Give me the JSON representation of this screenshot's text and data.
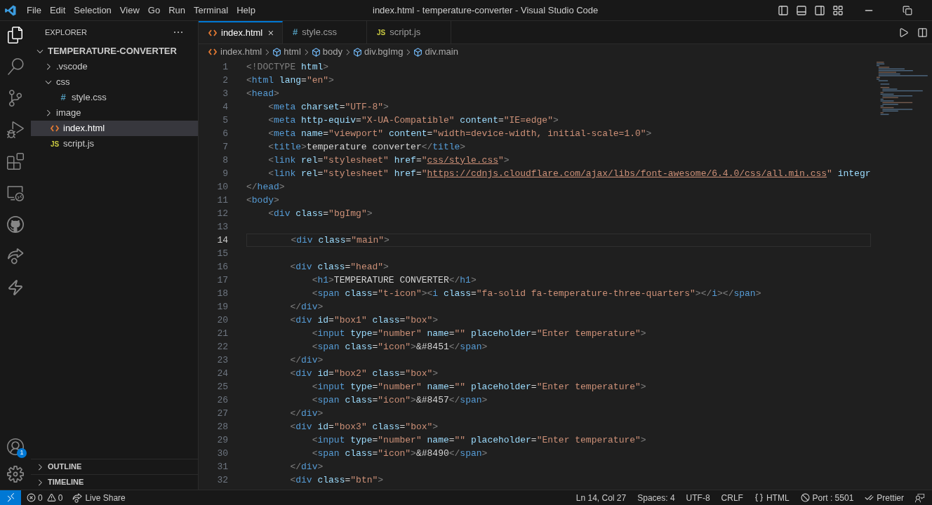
{
  "menu": [
    "File",
    "Edit",
    "Selection",
    "View",
    "Go",
    "Run",
    "Terminal",
    "Help"
  ],
  "window": {
    "title": "index.html - temperature-converter - Visual Studio Code"
  },
  "activity_bar": {
    "account_badge": "1"
  },
  "sidebar": {
    "title": "EXPLORER",
    "root": {
      "label": "TEMPERATURE-CONVERTER",
      "kind": "folder",
      "expanded": true,
      "selected": false,
      "children": [
        {
          "label": ".vscode",
          "kind": "folder",
          "expanded": false,
          "selected": false
        },
        {
          "label": "css",
          "kind": "folder",
          "expanded": true,
          "selected": false,
          "children": [
            {
              "label": "style.css",
              "kind": "css",
              "icon_text": "#",
              "selected": false
            }
          ]
        },
        {
          "label": "image",
          "kind": "folder",
          "expanded": false,
          "selected": false
        },
        {
          "label": "index.html",
          "kind": "html",
          "selected": true
        },
        {
          "label": "script.js",
          "kind": "js",
          "icon_text": "JS",
          "selected": false
        }
      ]
    },
    "sections": [
      {
        "label": "OUTLINE",
        "expanded": false
      },
      {
        "label": "TIMELINE",
        "expanded": false
      }
    ]
  },
  "tabs": [
    {
      "label": "index.html",
      "kind": "html",
      "selected": true
    },
    {
      "label": "style.css",
      "kind": "css",
      "icon_text": "#",
      "selected": false
    },
    {
      "label": "script.js",
      "kind": "js",
      "icon_text": "JS",
      "selected": false
    }
  ],
  "breadcrumb": [
    {
      "label": "index.html",
      "kind": "html"
    },
    {
      "label": "html",
      "kind": "element"
    },
    {
      "label": "body",
      "kind": "element"
    },
    {
      "label": "div.bgImg",
      "kind": "element"
    },
    {
      "label": "div.main",
      "kind": "element"
    }
  ],
  "editor": {
    "lines": [
      {
        "number": "1",
        "current": false,
        "parts": [
          {
            "kind": "code",
            "text": "<!DOCTYPE html>"
          }
        ]
      },
      {
        "number": "2",
        "current": false,
        "parts": [
          {
            "kind": "code",
            "text": "<html lang=\"en\">"
          }
        ]
      },
      {
        "number": "3",
        "current": false,
        "parts": [
          {
            "kind": "code",
            "text": "<head>"
          }
        ]
      },
      {
        "number": "4",
        "current": false,
        "parts": [
          {
            "kind": "code",
            "text": "    <meta charset=\"UTF-8\">"
          }
        ]
      },
      {
        "number": "5",
        "current": false,
        "parts": [
          {
            "kind": "code",
            "text": "    <meta http-equiv=\"X-UA-Compatible\" content=\"IE=edge\">"
          }
        ]
      },
      {
        "number": "6",
        "current": false,
        "parts": [
          {
            "kind": "code",
            "text": "    <meta name=\"viewport\" content=\"width=device-width, initial-scale=1.0\">"
          }
        ]
      },
      {
        "number": "7",
        "current": false,
        "parts": [
          {
            "kind": "code",
            "text": "    <title>temperature converter</title>"
          }
        ]
      },
      {
        "number": "8",
        "current": false,
        "parts": [
          {
            "kind": "code",
            "text": "    <link rel=\"stylesheet\" href=\""
          },
          {
            "kind": "link",
            "text": "css/style.css"
          },
          {
            "kind": "code",
            "text": "\">"
          }
        ]
      },
      {
        "number": "9",
        "current": false,
        "parts": [
          {
            "kind": "code",
            "text": "    <link rel=\"stylesheet\" href=\""
          },
          {
            "kind": "link",
            "text": "https://cdnjs.cloudflare.com/ajax/libs/font-awesome/6.4.0/css/all.min.css"
          },
          {
            "kind": "code",
            "text": "\" integr"
          }
        ]
      },
      {
        "number": "10",
        "current": false,
        "parts": [
          {
            "kind": "code",
            "text": "</head>"
          }
        ]
      },
      {
        "number": "11",
        "current": false,
        "parts": [
          {
            "kind": "code",
            "text": "<body>"
          }
        ]
      },
      {
        "number": "12",
        "current": false,
        "parts": [
          {
            "kind": "code",
            "text": "    <div class=\"bgImg\">"
          }
        ]
      },
      {
        "number": "13",
        "current": false
      },
      {
        "number": "14",
        "current": true,
        "parts": [
          {
            "kind": "code",
            "text": "        <div class=\"main\">"
          }
        ]
      },
      {
        "number": "15",
        "current": false
      },
      {
        "number": "16",
        "current": false,
        "parts": [
          {
            "kind": "code",
            "text": "        <div class=\"head\">"
          }
        ]
      },
      {
        "number": "17",
        "current": false,
        "parts": [
          {
            "kind": "code",
            "text": "            <h1>TEMPERATURE CONVERTER</h1>"
          }
        ]
      },
      {
        "number": "18",
        "current": false,
        "parts": [
          {
            "kind": "code",
            "text": "            <span class=\"t-icon\"><i class=\"fa-solid fa-temperature-three-quarters\"></i></span>"
          }
        ]
      },
      {
        "number": "19",
        "current": false,
        "parts": [
          {
            "kind": "code",
            "text": "        </div>"
          }
        ]
      },
      {
        "number": "20",
        "current": false,
        "parts": [
          {
            "kind": "code",
            "text": "        <div id=\"box1\" class=\"box\">"
          }
        ]
      },
      {
        "number": "21",
        "current": false,
        "parts": [
          {
            "kind": "code",
            "text": "            <input type=\"number\" name=\"\" placeholder=\"Enter temperature\">"
          }
        ]
      },
      {
        "number": "22",
        "current": false,
        "parts": [
          {
            "kind": "code",
            "text": "            <span class=\"icon\">&#8451</span>"
          }
        ]
      },
      {
        "number": "23",
        "current": false,
        "parts": [
          {
            "kind": "code",
            "text": "        </div>"
          }
        ]
      },
      {
        "number": "24",
        "current": false,
        "parts": [
          {
            "kind": "code",
            "text": "        <div id=\"box2\" class=\"box\">"
          }
        ]
      },
      {
        "number": "25",
        "current": false,
        "parts": [
          {
            "kind": "code",
            "text": "            <input type=\"number\" name=\"\" placeholder=\"Enter temperature\">"
          }
        ]
      },
      {
        "number": "26",
        "current": false,
        "parts": [
          {
            "kind": "code",
            "text": "            <span class=\"icon\">&#8457</span>"
          }
        ]
      },
      {
        "number": "27",
        "current": false,
        "parts": [
          {
            "kind": "code",
            "text": "        </div>"
          }
        ]
      },
      {
        "number": "28",
        "current": false,
        "parts": [
          {
            "kind": "code",
            "text": "        <div id=\"box3\" class=\"box\">"
          }
        ]
      },
      {
        "number": "29",
        "current": false,
        "parts": [
          {
            "kind": "code",
            "text": "            <input type=\"number\" name=\"\" placeholder=\"Enter temperature\">"
          }
        ]
      },
      {
        "number": "30",
        "current": false,
        "parts": [
          {
            "kind": "code",
            "text": "            <span class=\"icon\">&#8490</span>"
          }
        ]
      },
      {
        "number": "31",
        "current": false,
        "parts": [
          {
            "kind": "code",
            "text": "        </div>"
          }
        ]
      },
      {
        "number": "32",
        "current": false,
        "parts": [
          {
            "kind": "code",
            "text": "        <div class=\"btn\">"
          }
        ]
      }
    ]
  },
  "status_bar": {
    "errors": "0",
    "warnings": "0",
    "live_share": "Live Share",
    "items": [
      "Ln 14, Col 27",
      "Spaces: 4",
      "UTF-8",
      "CRLF"
    ],
    "language": "HTML",
    "port": "Port : 5501",
    "formatter": "Prettier"
  }
}
